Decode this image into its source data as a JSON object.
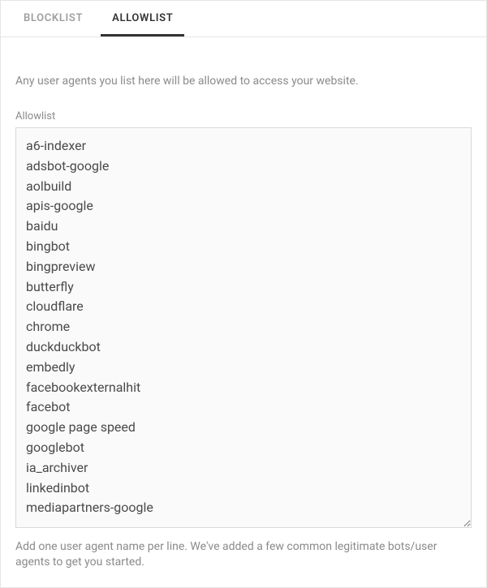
{
  "tabs": [
    {
      "label": "BLOCKLIST",
      "active": false
    },
    {
      "label": "ALLOWLIST",
      "active": true
    }
  ],
  "description": "Any user agents you list here will be allowed to access your website.",
  "field_label": "Allowlist",
  "allowlist_entries": [
    "a6-indexer",
    "adsbot-google",
    "aolbuild",
    "apis-google",
    "baidu",
    "bingbot",
    "bingpreview",
    "butterfly",
    "cloudflare",
    "chrome",
    "duckduckbot",
    "embedly",
    "facebookexternalhit",
    "facebot",
    "google page speed",
    "googlebot",
    "ia_archiver",
    "linkedinbot",
    "mediapartners-google"
  ],
  "hint": "Add one user agent name per line. We've added a few common legitimate bots/user agents to get you started."
}
